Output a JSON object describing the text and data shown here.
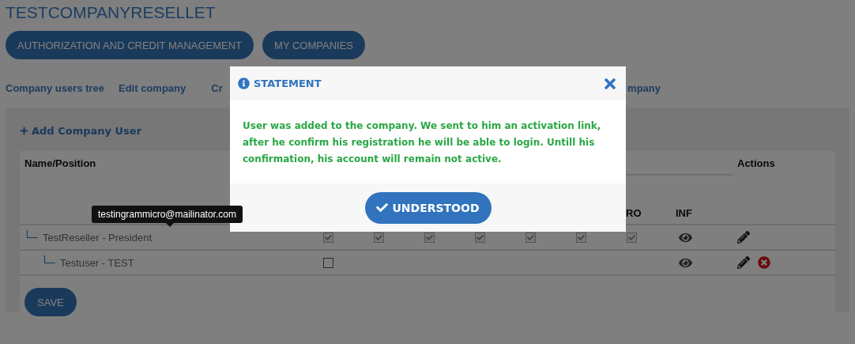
{
  "page": {
    "title": "TESTCOMPANYRESELLET"
  },
  "top_buttons": [
    "AUTHORIZATION AND CREDIT MANAGEMENT",
    "MY COMPANIES"
  ],
  "nav_links": [
    "Company users tree",
    "Edit company",
    "Cr",
    "mpany"
  ],
  "panel": {
    "add_user": "Add Company User",
    "table": {
      "name_header": "Name/Position",
      "actions_header": "Actions",
      "column_7": "RO",
      "inf_header": "INF",
      "rows": [
        {
          "name": "TestReseller - President",
          "deletable": false,
          "permissions": [
            {
              "kind": "checkbox",
              "checked": true,
              "disabled": true
            },
            {
              "kind": "checkbox",
              "checked": true,
              "disabled": true
            },
            {
              "kind": "checkbox",
              "checked": true,
              "disabled": true
            },
            {
              "kind": "checkbox",
              "checked": true,
              "disabled": true
            },
            {
              "kind": "checkbox",
              "checked": true,
              "disabled": true
            },
            {
              "kind": "checkbox",
              "checked": true,
              "disabled": true
            },
            {
              "kind": "checkbox",
              "checked": true,
              "disabled": true
            }
          ],
          "children": [
            {
              "name": "Testuser - TEST",
              "deletable": true,
              "permissions": [
                {
                  "kind": "checkbox",
                  "checked": false,
                  "disabled": false
                },
                {
                  "kind": "empty"
                },
                {
                  "kind": "empty"
                },
                {
                  "kind": "empty"
                },
                {
                  "kind": "empty"
                },
                {
                  "kind": "empty"
                },
                {
                  "kind": "empty"
                }
              ]
            }
          ]
        }
      ]
    },
    "save_button": "SAVE"
  },
  "tooltip": "testingrammicro@mailinator.com",
  "modal": {
    "title": "STATEMENT",
    "message": "User was added to the company. We sent to him an activation link, after he confirm his registration he will be able to login. Untill his confirmation, his account will remain not active.",
    "button": "UNDERSTOOD"
  }
}
